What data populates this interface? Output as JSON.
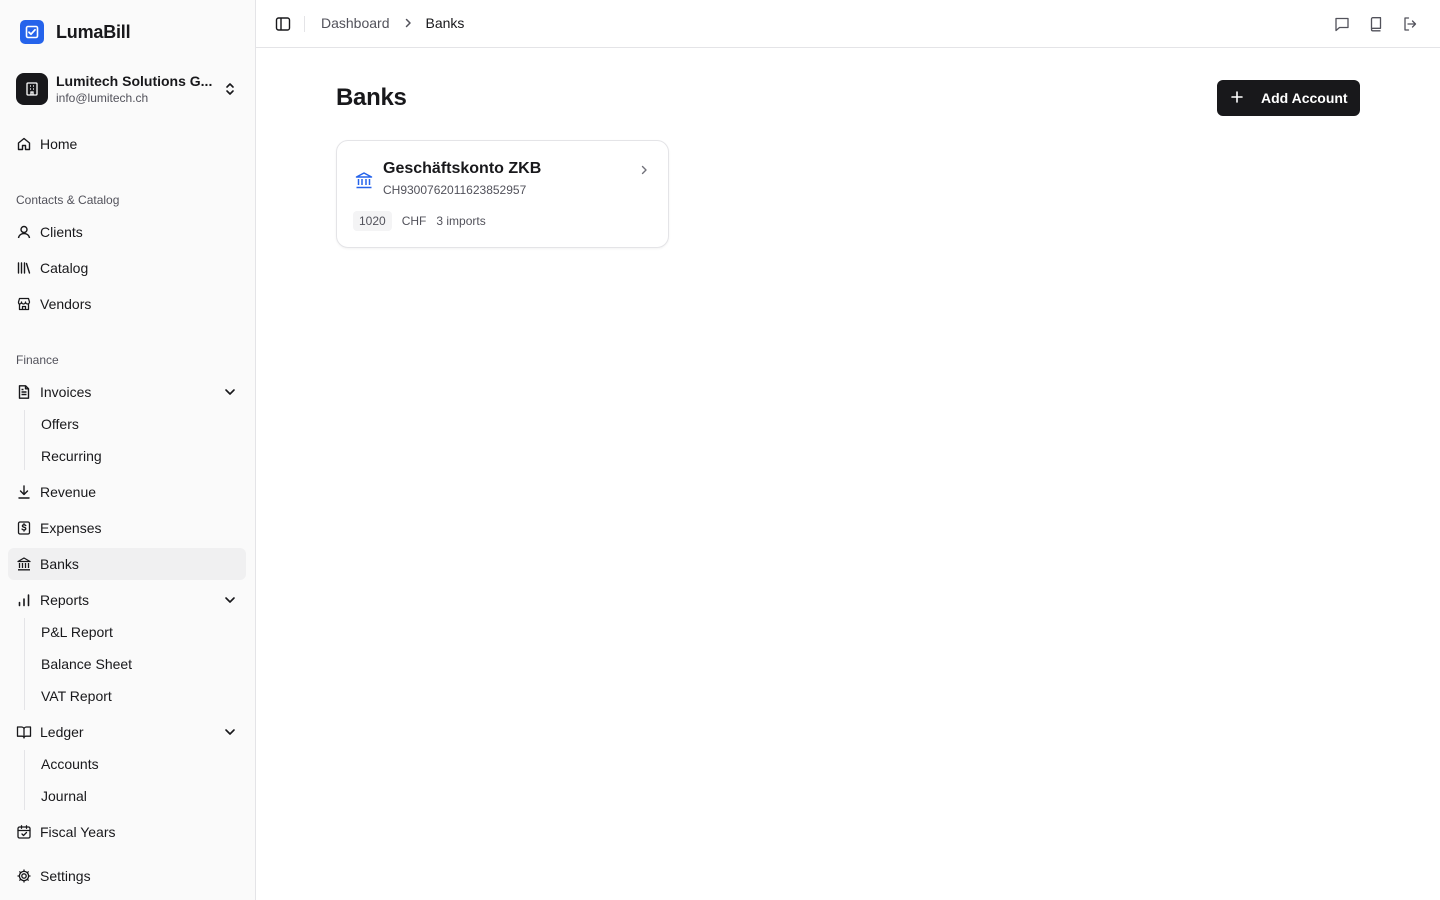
{
  "app": {
    "name": "LumaBill",
    "brand_color": "#2563eb"
  },
  "org": {
    "name": "Lumitech Solutions G...",
    "email": "info@lumitech.ch"
  },
  "sidebar": {
    "home": "Home",
    "section_contacts": "Contacts & Catalog",
    "clients": "Clients",
    "catalog": "Catalog",
    "vendors": "Vendors",
    "section_finance": "Finance",
    "invoices": "Invoices",
    "invoices_sub": [
      "Offers",
      "Recurring"
    ],
    "revenue": "Revenue",
    "expenses": "Expenses",
    "banks": "Banks",
    "reports": "Reports",
    "reports_sub": [
      "P&L Report",
      "Balance Sheet",
      "VAT Report"
    ],
    "ledger": "Ledger",
    "ledger_sub": [
      "Accounts",
      "Journal"
    ],
    "fiscal_years": "Fiscal Years",
    "settings": "Settings"
  },
  "topbar": {
    "breadcrumb": [
      "Dashboard",
      "Banks"
    ]
  },
  "page": {
    "title": "Banks",
    "add_button": "Add Account"
  },
  "accounts": [
    {
      "name": "Geschäftskonto ZKB",
      "iban": "CH9300762011623852957",
      "number": "1020",
      "currency": "CHF",
      "imports": "3 imports"
    }
  ]
}
